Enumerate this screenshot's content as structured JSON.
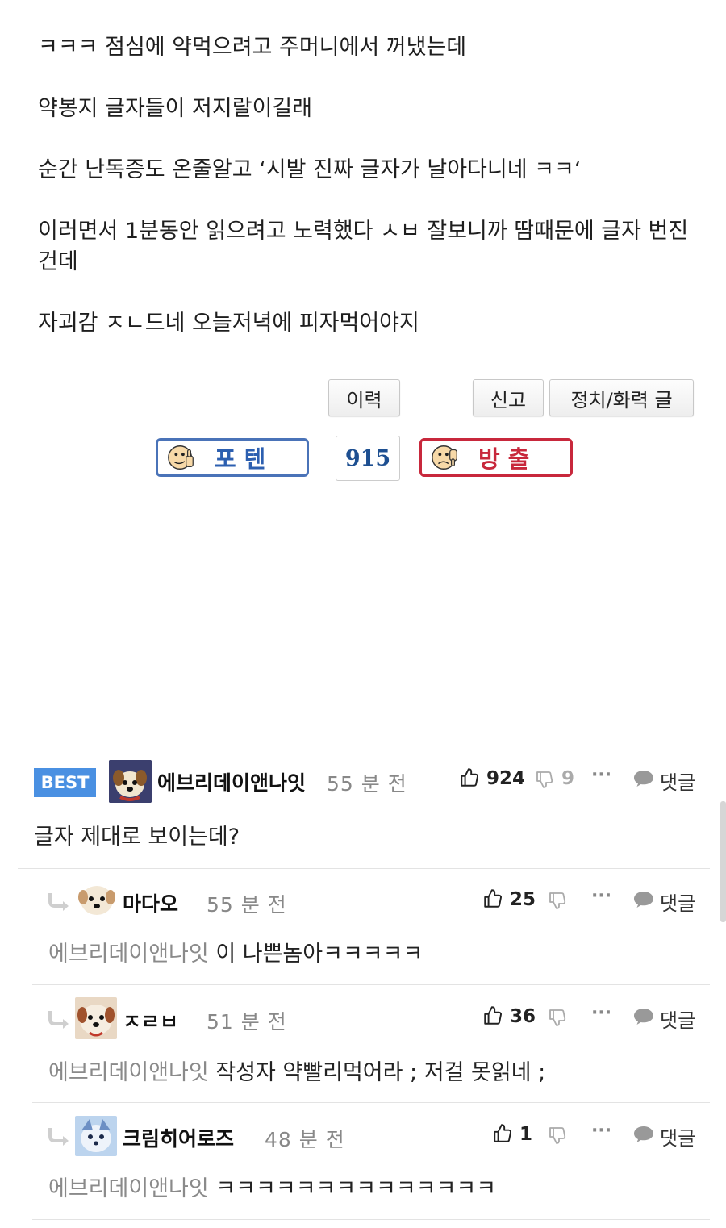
{
  "post": {
    "paragraphs": [
      "ㅋㅋㅋ 점심에 약먹으려고 주머니에서 꺼냈는데",
      "약봉지 글자들이 저지랄이길래",
      "순간 난독증도 온줄알고 ‘시발 진짜 글자가 날아다니네 ㅋㅋ‘",
      "이러면서 1분동안 읽으려고 노력했다 ㅅㅂ 잘보니까 땀때문에 글자 번진건데",
      "자괴감 ㅈㄴ드네 오늘저녁에 피자먹어야지"
    ]
  },
  "actions": {
    "history_label": "이력",
    "report_label": "신고",
    "politics_label": "정치/화력 글"
  },
  "votes": {
    "up_label": "포텐",
    "count": "915",
    "down_label": "방출"
  },
  "comments": {
    "best_badge": "BEST",
    "reply_label": "댓글",
    "more_label": "···",
    "items": [
      {
        "nick": "에브리데이앤나잇",
        "time": "55 분 전",
        "likes": "924",
        "dislikes": "9",
        "text": "글자 제대로 보이는데?",
        "mention": ""
      },
      {
        "nick": "마다오",
        "time": "55 분 전",
        "likes": "25",
        "dislikes": "",
        "mention": "에브리데이앤나잇",
        "text": "이 나쁜놈아ㅋㅋㅋㅋㅋ"
      },
      {
        "nick": "ㅈㄹㅂ",
        "time": "51 분 전",
        "likes": "36",
        "dislikes": "",
        "mention": "에브리데이앤나잇",
        "text": "작성자 약빨리먹어라 ; 저걸 못읽네 ;"
      },
      {
        "nick": "크림히어로즈",
        "time": "48 분 전",
        "likes": "1",
        "dislikes": "",
        "mention": "에브리데이앤나잇",
        "text": "ㅋㅋㅋㅋㅋㅋㅋㅋㅋㅋㅋㅋㅋㅋ"
      }
    ]
  },
  "colors": {
    "best_blue": "#4a90e2",
    "up_border": "#4a73b8",
    "down_border": "#c8283c",
    "count_blue": "#1d4f91"
  }
}
